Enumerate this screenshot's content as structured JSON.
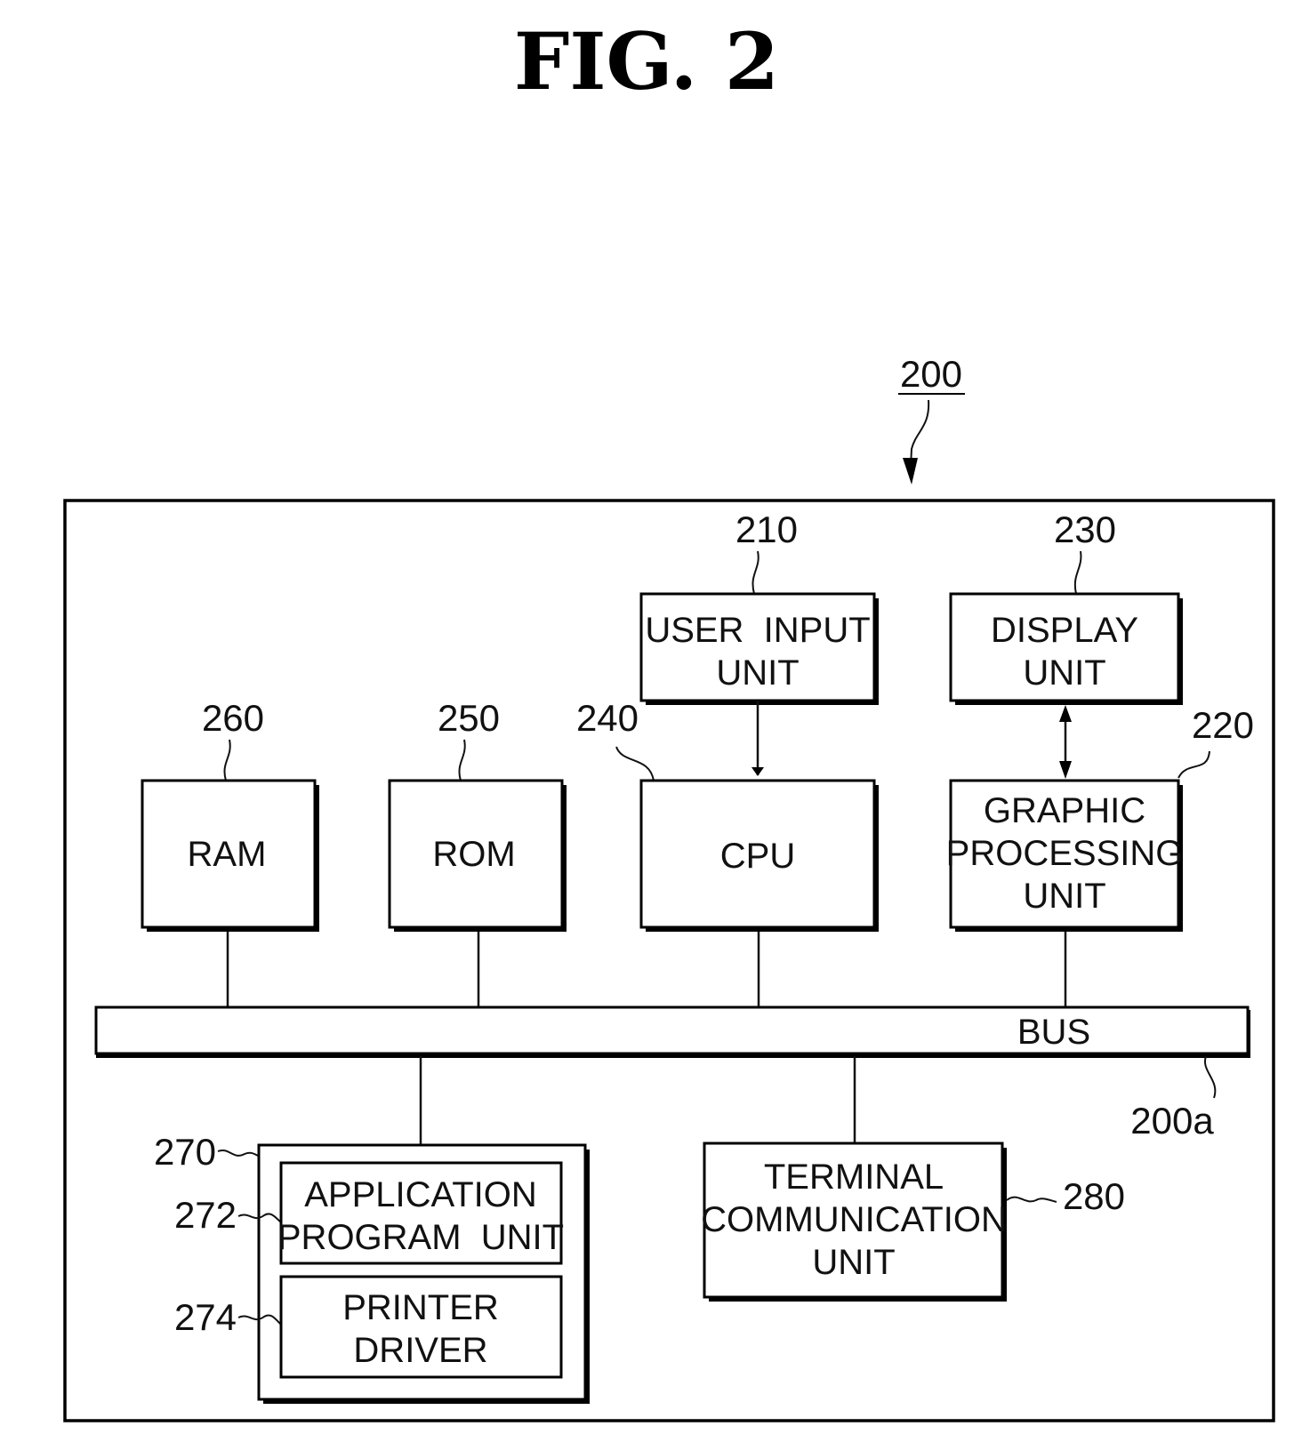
{
  "figure": {
    "title": "FIG. 2",
    "system_ref": "200"
  },
  "blocks": {
    "user_input": {
      "ref": "210",
      "lines": [
        "USER  INPUT",
        "UNIT"
      ]
    },
    "display": {
      "ref": "230",
      "lines": [
        "DISPLAY",
        "UNIT"
      ]
    },
    "gpu": {
      "ref": "220",
      "lines": [
        "GRAPHIC",
        "PROCESSING",
        "UNIT"
      ]
    },
    "cpu": {
      "ref": "240",
      "lines": [
        "CPU"
      ]
    },
    "rom": {
      "ref": "250",
      "lines": [
        "ROM"
      ]
    },
    "ram": {
      "ref": "260",
      "lines": [
        "RAM"
      ]
    },
    "bus": {
      "ref": "200a",
      "label": "BUS"
    },
    "storage": {
      "ref": "270"
    },
    "app_program": {
      "ref": "272",
      "lines": [
        "APPLICATION",
        "PROGRAM  UNIT"
      ]
    },
    "printer_driver": {
      "ref": "274",
      "lines": [
        "PRINTER",
        "DRIVER"
      ]
    },
    "terminal_comm": {
      "ref": "280",
      "lines": [
        "TERMINAL",
        "COMMUNICATION",
        "UNIT"
      ]
    }
  },
  "connections": [
    {
      "from": "user_input",
      "to": "cpu",
      "type": "arrow"
    },
    {
      "from": "display",
      "to": "gpu",
      "type": "bidirectional-arrow"
    },
    {
      "from": "ram",
      "to": "bus",
      "type": "line"
    },
    {
      "from": "rom",
      "to": "bus",
      "type": "line"
    },
    {
      "from": "cpu",
      "to": "bus",
      "type": "line"
    },
    {
      "from": "gpu",
      "to": "bus",
      "type": "line"
    },
    {
      "from": "bus",
      "to": "storage",
      "type": "line"
    },
    {
      "from": "bus",
      "to": "terminal_comm",
      "type": "line"
    }
  ]
}
